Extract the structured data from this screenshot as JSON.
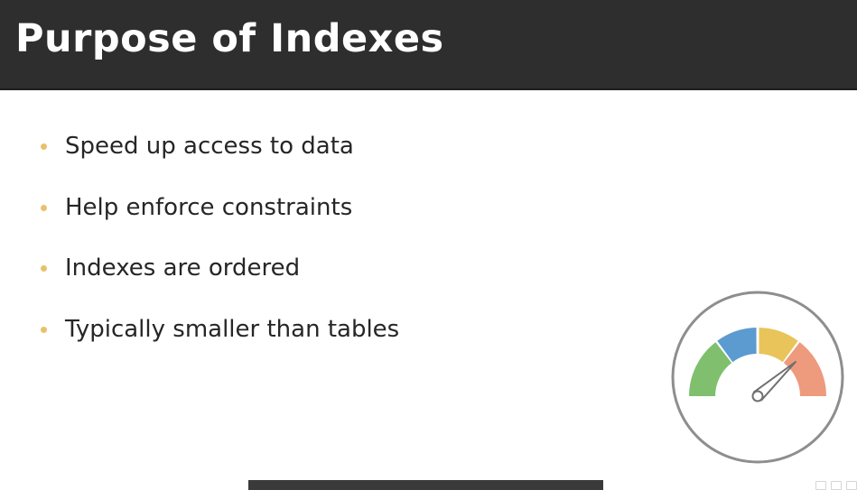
{
  "slide": {
    "title": "Purpose of Indexes",
    "bullets": [
      "Speed up access to data",
      "Help enforce constraints",
      "Indexes are ordered",
      "Typically smaller than tables"
    ]
  },
  "colors": {
    "header_bg": "#2e2e2e",
    "bullet_dot": "#e8c16a",
    "gauge_green": "#7fbf6e",
    "gauge_blue": "#5b9bd0",
    "gauge_yellow": "#e9c45a",
    "gauge_salmon": "#ee9a7d"
  },
  "icons": {
    "gauge": "speedometer-icon"
  }
}
